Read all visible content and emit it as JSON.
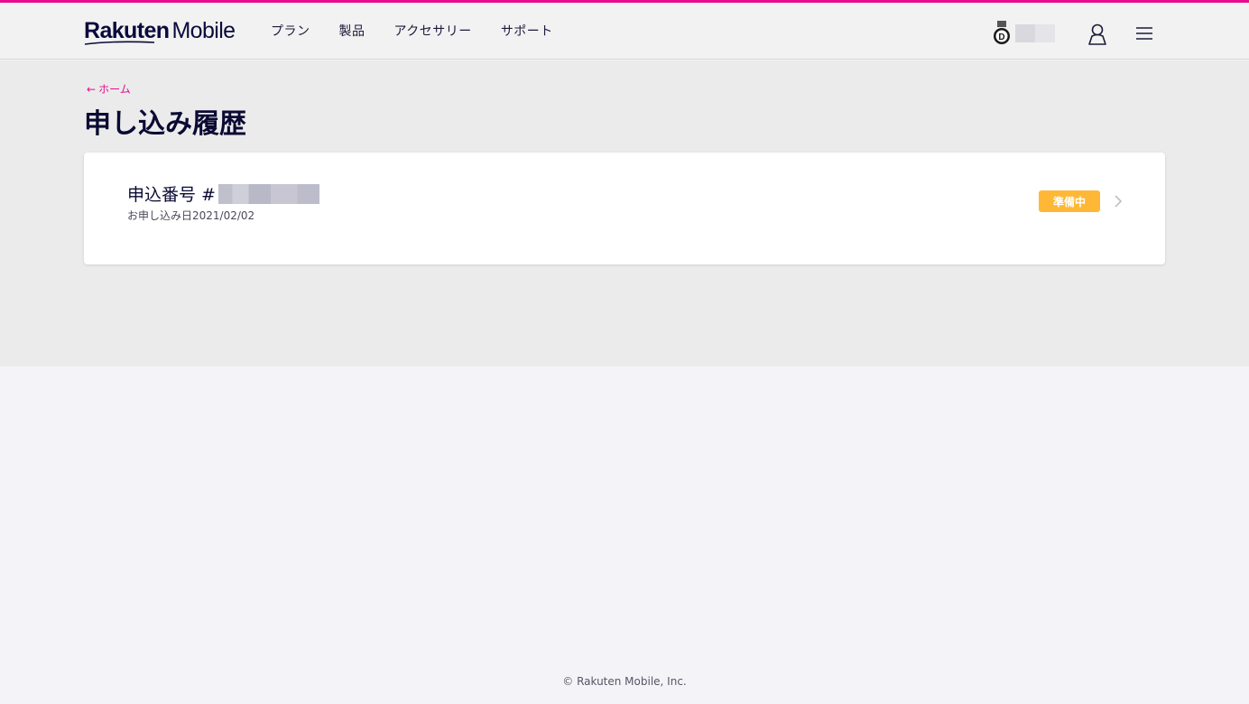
{
  "header": {
    "logo_brand": "Rakuten",
    "logo_product": "Mobile",
    "nav": [
      {
        "label": "プラン"
      },
      {
        "label": "製品"
      },
      {
        "label": "アクセサリー"
      },
      {
        "label": "サポート"
      }
    ],
    "icons": {
      "badge": "rank-badge-icon",
      "user": "user-icon",
      "menu": "hamburger-menu-icon"
    }
  },
  "breadcrumb": {
    "arrow": "←",
    "label": "ホーム"
  },
  "page": {
    "title": "申し込み履歴"
  },
  "orders": [
    {
      "number_label": "申込番号 #",
      "date_label": "お申し込み日2021/02/02",
      "status": "準備中"
    }
  ],
  "footer": {
    "copyright": "© Rakuten Mobile, Inc."
  },
  "colors": {
    "accent": "#ea0a8e",
    "status_preparing": "#ffb836",
    "text_dark": "#0a0a33"
  }
}
